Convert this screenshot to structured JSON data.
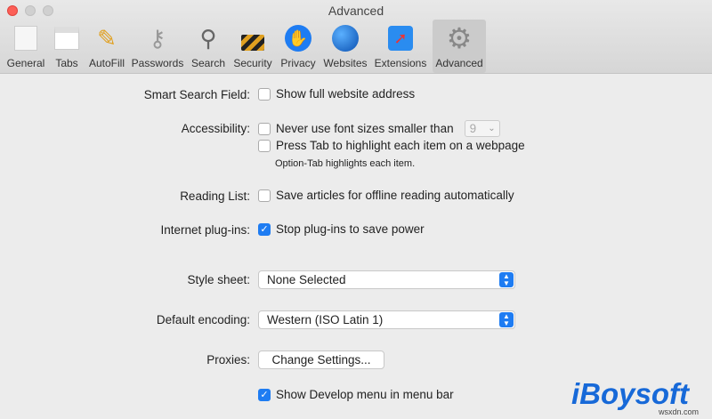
{
  "window": {
    "title": "Advanced"
  },
  "toolbar": [
    {
      "label": "General",
      "icon": "general-switch-icon"
    },
    {
      "label": "Tabs",
      "icon": "tabs-icon"
    },
    {
      "label": "AutoFill",
      "icon": "pencil-icon"
    },
    {
      "label": "Passwords",
      "icon": "key-icon"
    },
    {
      "label": "Search",
      "icon": "magnifier-icon"
    },
    {
      "label": "Security",
      "icon": "padlock-icon"
    },
    {
      "label": "Privacy",
      "icon": "hand-icon"
    },
    {
      "label": "Websites",
      "icon": "globe-icon"
    },
    {
      "label": "Extensions",
      "icon": "puzzle-compass-icon"
    },
    {
      "label": "Advanced",
      "icon": "gear-icon"
    }
  ],
  "settings": {
    "smart_search": {
      "label": "Smart Search Field:",
      "option": "Show full website address",
      "checked": false
    },
    "accessibility": {
      "label": "Accessibility:",
      "font_option": "Never use font sizes smaller than",
      "font_size": "9",
      "tab_option": "Press Tab to highlight each item on a webpage",
      "hint": "Option-Tab highlights each item."
    },
    "reading_list": {
      "label": "Reading List:",
      "option": "Save articles for offline reading automatically"
    },
    "plugins": {
      "label": "Internet plug-ins:",
      "option": "Stop plug-ins to save power",
      "checked": true
    },
    "style_sheet": {
      "label": "Style sheet:",
      "value": "None Selected"
    },
    "encoding": {
      "label": "Default encoding:",
      "value": "Western (ISO Latin 1)"
    },
    "proxies": {
      "label": "Proxies:",
      "button": "Change Settings..."
    },
    "develop": {
      "option": "Show Develop menu in menu bar",
      "checked": true
    }
  },
  "watermark": {
    "logo": "iBoysoft",
    "site": "wsxdn.com"
  },
  "colors": {
    "accent": "#1e7cf2"
  }
}
